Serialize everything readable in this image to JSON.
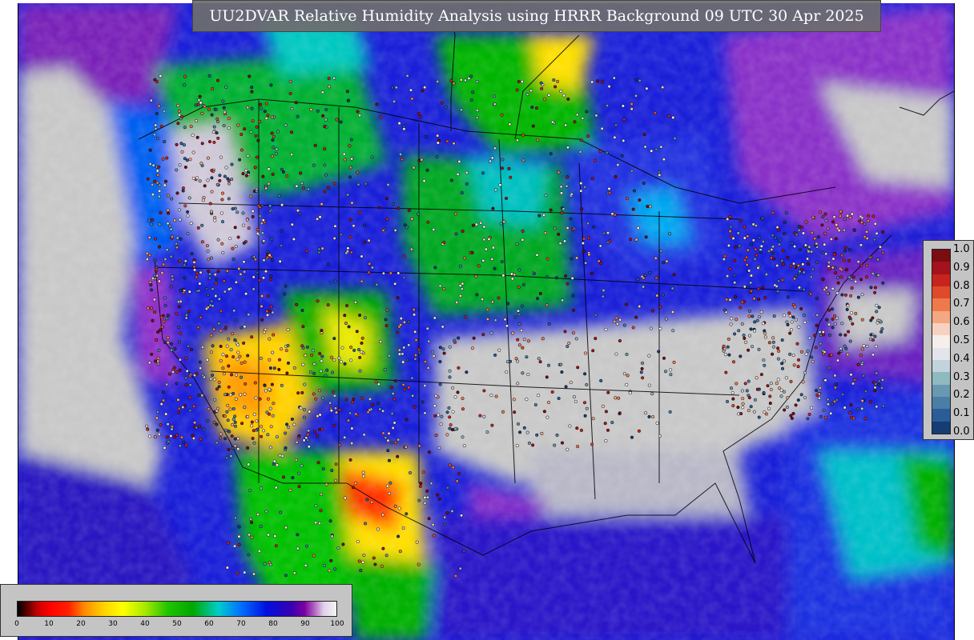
{
  "title": "UU2DVAR Relative Humidity Analysis using HRRR Background 09 UTC 30 Apr 2025",
  "observation_legend": {
    "ticks": [
      "1.0",
      "0.9",
      "0.8",
      "0.7",
      "0.6",
      "0.5",
      "0.4",
      "0.3",
      "0.2",
      "0.1",
      "0.0"
    ],
    "colors": [
      "#7a0c12",
      "#a3121d",
      "#c7241d",
      "#df4a2a",
      "#ee7a4c",
      "#f4a882",
      "#f8d2c0",
      "#f6eeea",
      "#e3e5ea",
      "#c2d3db",
      "#8fb9c1",
      "#6a98b0",
      "#4a7ea6",
      "#2a5d98",
      "#163c74"
    ]
  },
  "rh_colorbar": {
    "ticks": [
      "0",
      "10",
      "20",
      "30",
      "40",
      "50",
      "60",
      "70",
      "80",
      "90",
      "100"
    ]
  },
  "colors": {
    "land_bg": "#c8c8c8",
    "panel_bg": "#c4c4c4",
    "title_bg": "#6e6e6e"
  }
}
